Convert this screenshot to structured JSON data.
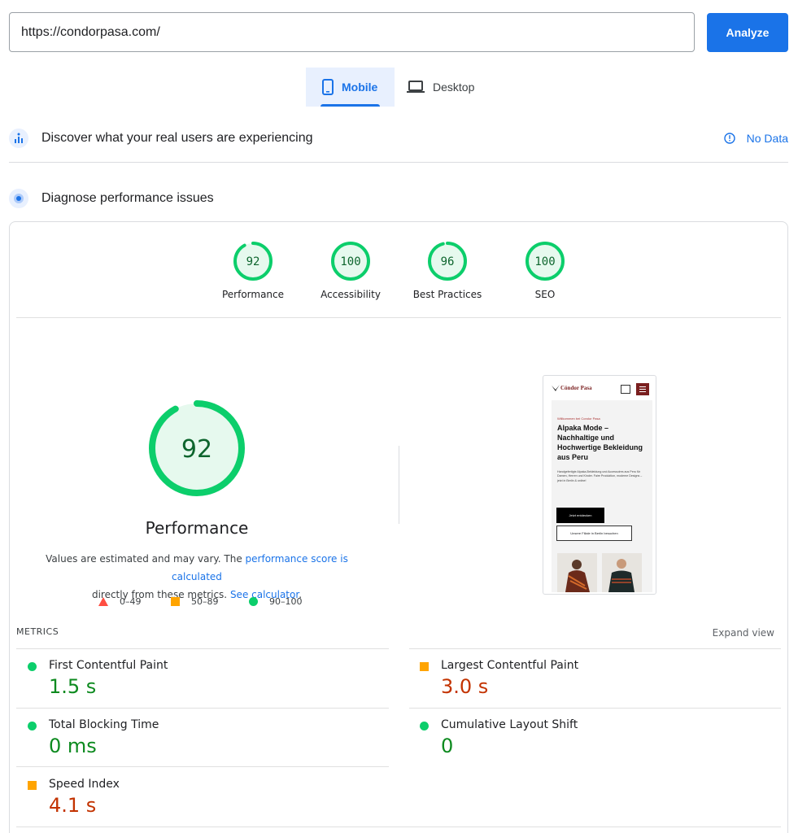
{
  "search": {
    "url": "https://condorpasa.com/",
    "analyze_label": "Analyze"
  },
  "tabs": {
    "mobile": "Mobile",
    "desktop": "Desktop"
  },
  "real_users": {
    "title": "Discover what your real users are experiencing",
    "status": "No Data"
  },
  "diagnose": {
    "title": "Diagnose performance issues"
  },
  "scores": [
    {
      "label": "Performance",
      "value": "92"
    },
    {
      "label": "Accessibility",
      "value": "100"
    },
    {
      "label": "Best Practices",
      "value": "96"
    },
    {
      "label": "SEO",
      "value": "100"
    }
  ],
  "performance": {
    "score": "92",
    "title": "Performance",
    "desc_before": "Values are estimated and may vary. The ",
    "desc_link1": "performance score is calculated",
    "desc_middle": " directly from these metrics.",
    "desc_link2": "See calculator",
    "desc_after": "."
  },
  "legend": {
    "fail": "0–49",
    "average": "50–89",
    "pass": "90–100"
  },
  "screenshot": {
    "logo": "Cóndor Pasa",
    "welcome": "Willkommen bei Condor Pasa",
    "headline": "Alpaka Mode – Nachhaltige und Hochwertige Bekleidung aus Peru",
    "paragraph": "Handgefertigte Alpaka-Bekleidung und Accessoires aus Peru für Damen, Herren und Kinder. Faire Produktion, moderne Designs – jetzt in Berlin & online!",
    "button1": "Jetzt entdecken",
    "button2": "Unsere Filiale in Berlin besuchen"
  },
  "metrics": {
    "title": "METRICS",
    "expand": "Expand view",
    "fcp": {
      "label": "First Contentful Paint",
      "value": "1.5 s",
      "rating": "pass"
    },
    "lcp": {
      "label": "Largest Contentful Paint",
      "value": "3.0 s",
      "rating": "average"
    },
    "tbt": {
      "label": "Total Blocking Time",
      "value": "0 ms",
      "rating": "pass"
    },
    "cls": {
      "label": "Cumulative Layout Shift",
      "value": "0",
      "rating": "pass"
    },
    "si": {
      "label": "Speed Index",
      "value": "4.1 s",
      "rating": "average"
    }
  },
  "colors": {
    "accent": "#1a73e8",
    "pass": "#0cce6b",
    "average": "#ffa400",
    "fail": "#ff4e42"
  }
}
